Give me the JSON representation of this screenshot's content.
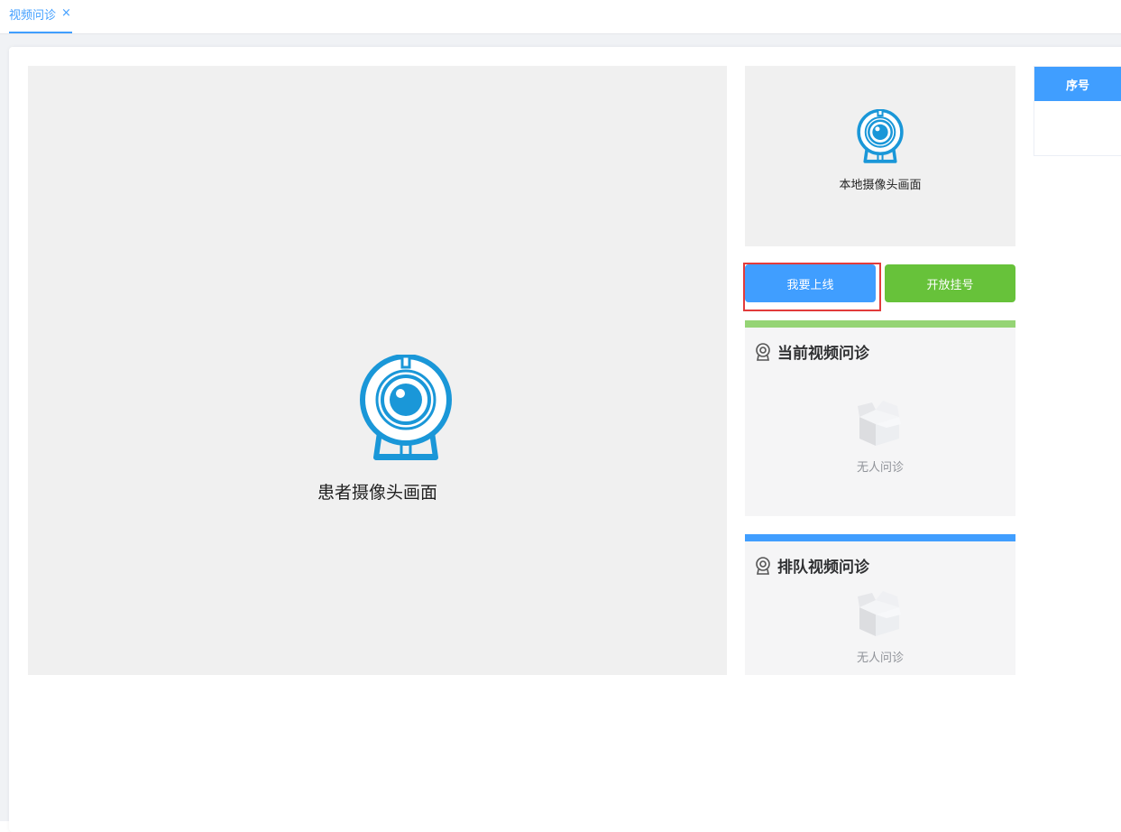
{
  "tab": {
    "label": "视频问诊",
    "close_symbol": "×",
    "accent_color": "#409eff"
  },
  "patient_video": {
    "label": "患者摄像头画面",
    "icon": "webcam-icon"
  },
  "local_video": {
    "label": "本地摄像头画面",
    "icon": "webcam-icon"
  },
  "buttons": {
    "online_label": "我要上线",
    "open_registration_label": "开放挂号",
    "online_color": "#409eff",
    "open_registration_color": "#67c23a"
  },
  "current_panel": {
    "title": "当前视频问诊",
    "empty_text": "无人问诊",
    "accent_color": "#95d475",
    "icon": "webcam-small-icon"
  },
  "queue_panel": {
    "title": "排队视频问诊",
    "empty_text": "无人问诊",
    "accent_color": "#409eff",
    "icon": "webcam-small-icon"
  },
  "side_table": {
    "header": "序号"
  }
}
